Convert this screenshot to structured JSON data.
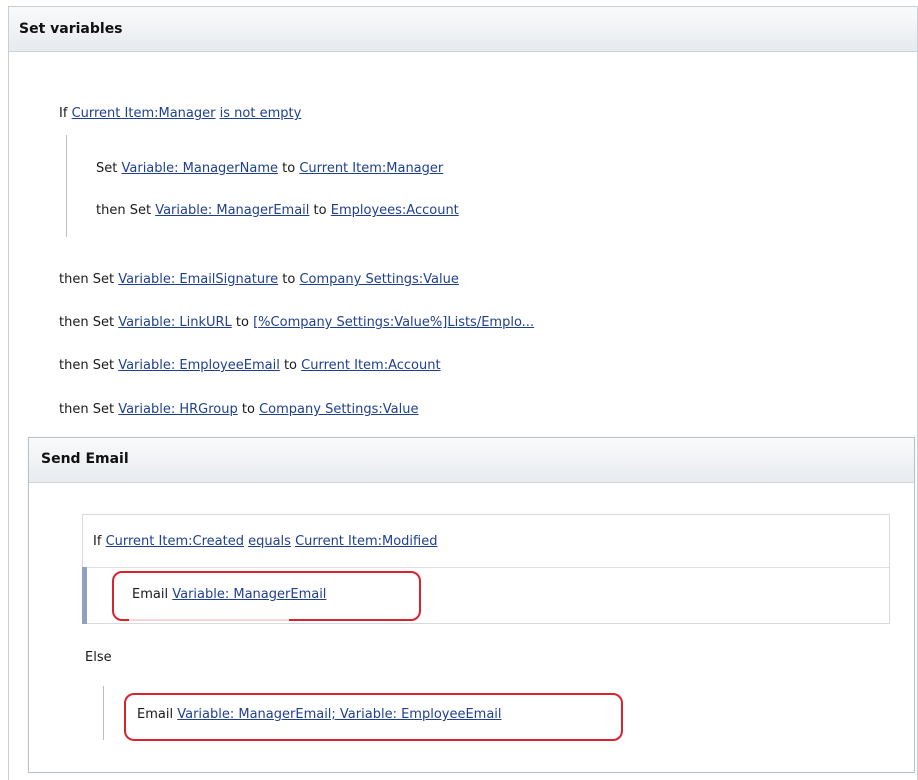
{
  "outer_step": {
    "title": "Set variables",
    "if_keyword": "If",
    "if_field": "Current Item:Manager",
    "if_operator": "is not empty",
    "nested_actions": [
      {
        "prefix": "Set",
        "variable": "Variable: ManagerName",
        "to_word": "to",
        "value": "Current Item:Manager"
      },
      {
        "prefix": "then Set",
        "variable": "Variable: ManagerEmail",
        "to_word": "to",
        "value": "Employees:Account"
      }
    ],
    "actions": [
      {
        "prefix": "then Set",
        "variable": "Variable: EmailSignature",
        "to_word": "to",
        "value": "Company Settings:Value"
      },
      {
        "prefix": "then Set",
        "variable": "Variable: LinkURL",
        "to_word": "to",
        "value": "[%Company Settings:Value%]Lists/Emplo..."
      },
      {
        "prefix": "then Set",
        "variable": "Variable: EmployeeEmail",
        "to_word": "to",
        "value": "Current Item:Account"
      },
      {
        "prefix": "then Set",
        "variable": "Variable: HRGroup",
        "to_word": "to",
        "value": "Company Settings:Value"
      }
    ]
  },
  "inner_step": {
    "title": "Send Email",
    "if_keyword": "If",
    "if_left": "Current Item:Created",
    "if_operator": "equals",
    "if_right": "Current Item:Modified",
    "then_email_keyword": "Email",
    "then_email_to": "Variable: ManagerEmail",
    "else_keyword": "Else",
    "else_email_keyword": "Email",
    "else_email_to": "Variable: ManagerEmail; Variable: EmployeeEmail"
  },
  "colors": {
    "link": "#1f3f8f",
    "highlight": "#d9242f",
    "header_bg": "#e7eaee"
  }
}
